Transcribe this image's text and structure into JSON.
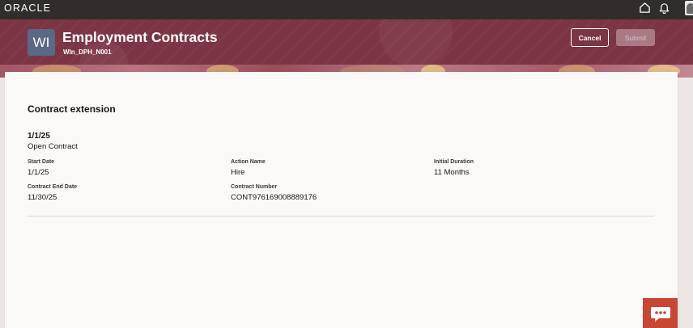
{
  "app": {
    "logo": "ORACLE"
  },
  "header": {
    "badge": "WI",
    "title": "Employment Contracts",
    "subtitle": "Wln_DPH_N001",
    "cancel_label": "Cancel",
    "submit_label": "Submit"
  },
  "card": {
    "section_title": "Contract extension",
    "summary_date": "1/1/25",
    "summary_type": "Open Contract",
    "fields": {
      "start_date": {
        "label": "Start Date",
        "value": "1/1/25"
      },
      "action_name": {
        "label": "Action Name",
        "value": "Hire"
      },
      "initial_duration": {
        "label": "Initial Duration",
        "value": "11 Months"
      },
      "contract_end_date": {
        "label": "Contract End Date",
        "value": "11/30/25"
      },
      "contract_number": {
        "label": "Contract Number",
        "value": "CONT976169008889176"
      }
    }
  },
  "icons": {
    "home": "home-icon",
    "notifications": "bell-icon",
    "user": "avatar",
    "chat": "chat-icon"
  },
  "colors": {
    "topbar": "#312d2a",
    "header": "#7c3545",
    "badge": "#5b6886",
    "chat": "#c74634"
  }
}
